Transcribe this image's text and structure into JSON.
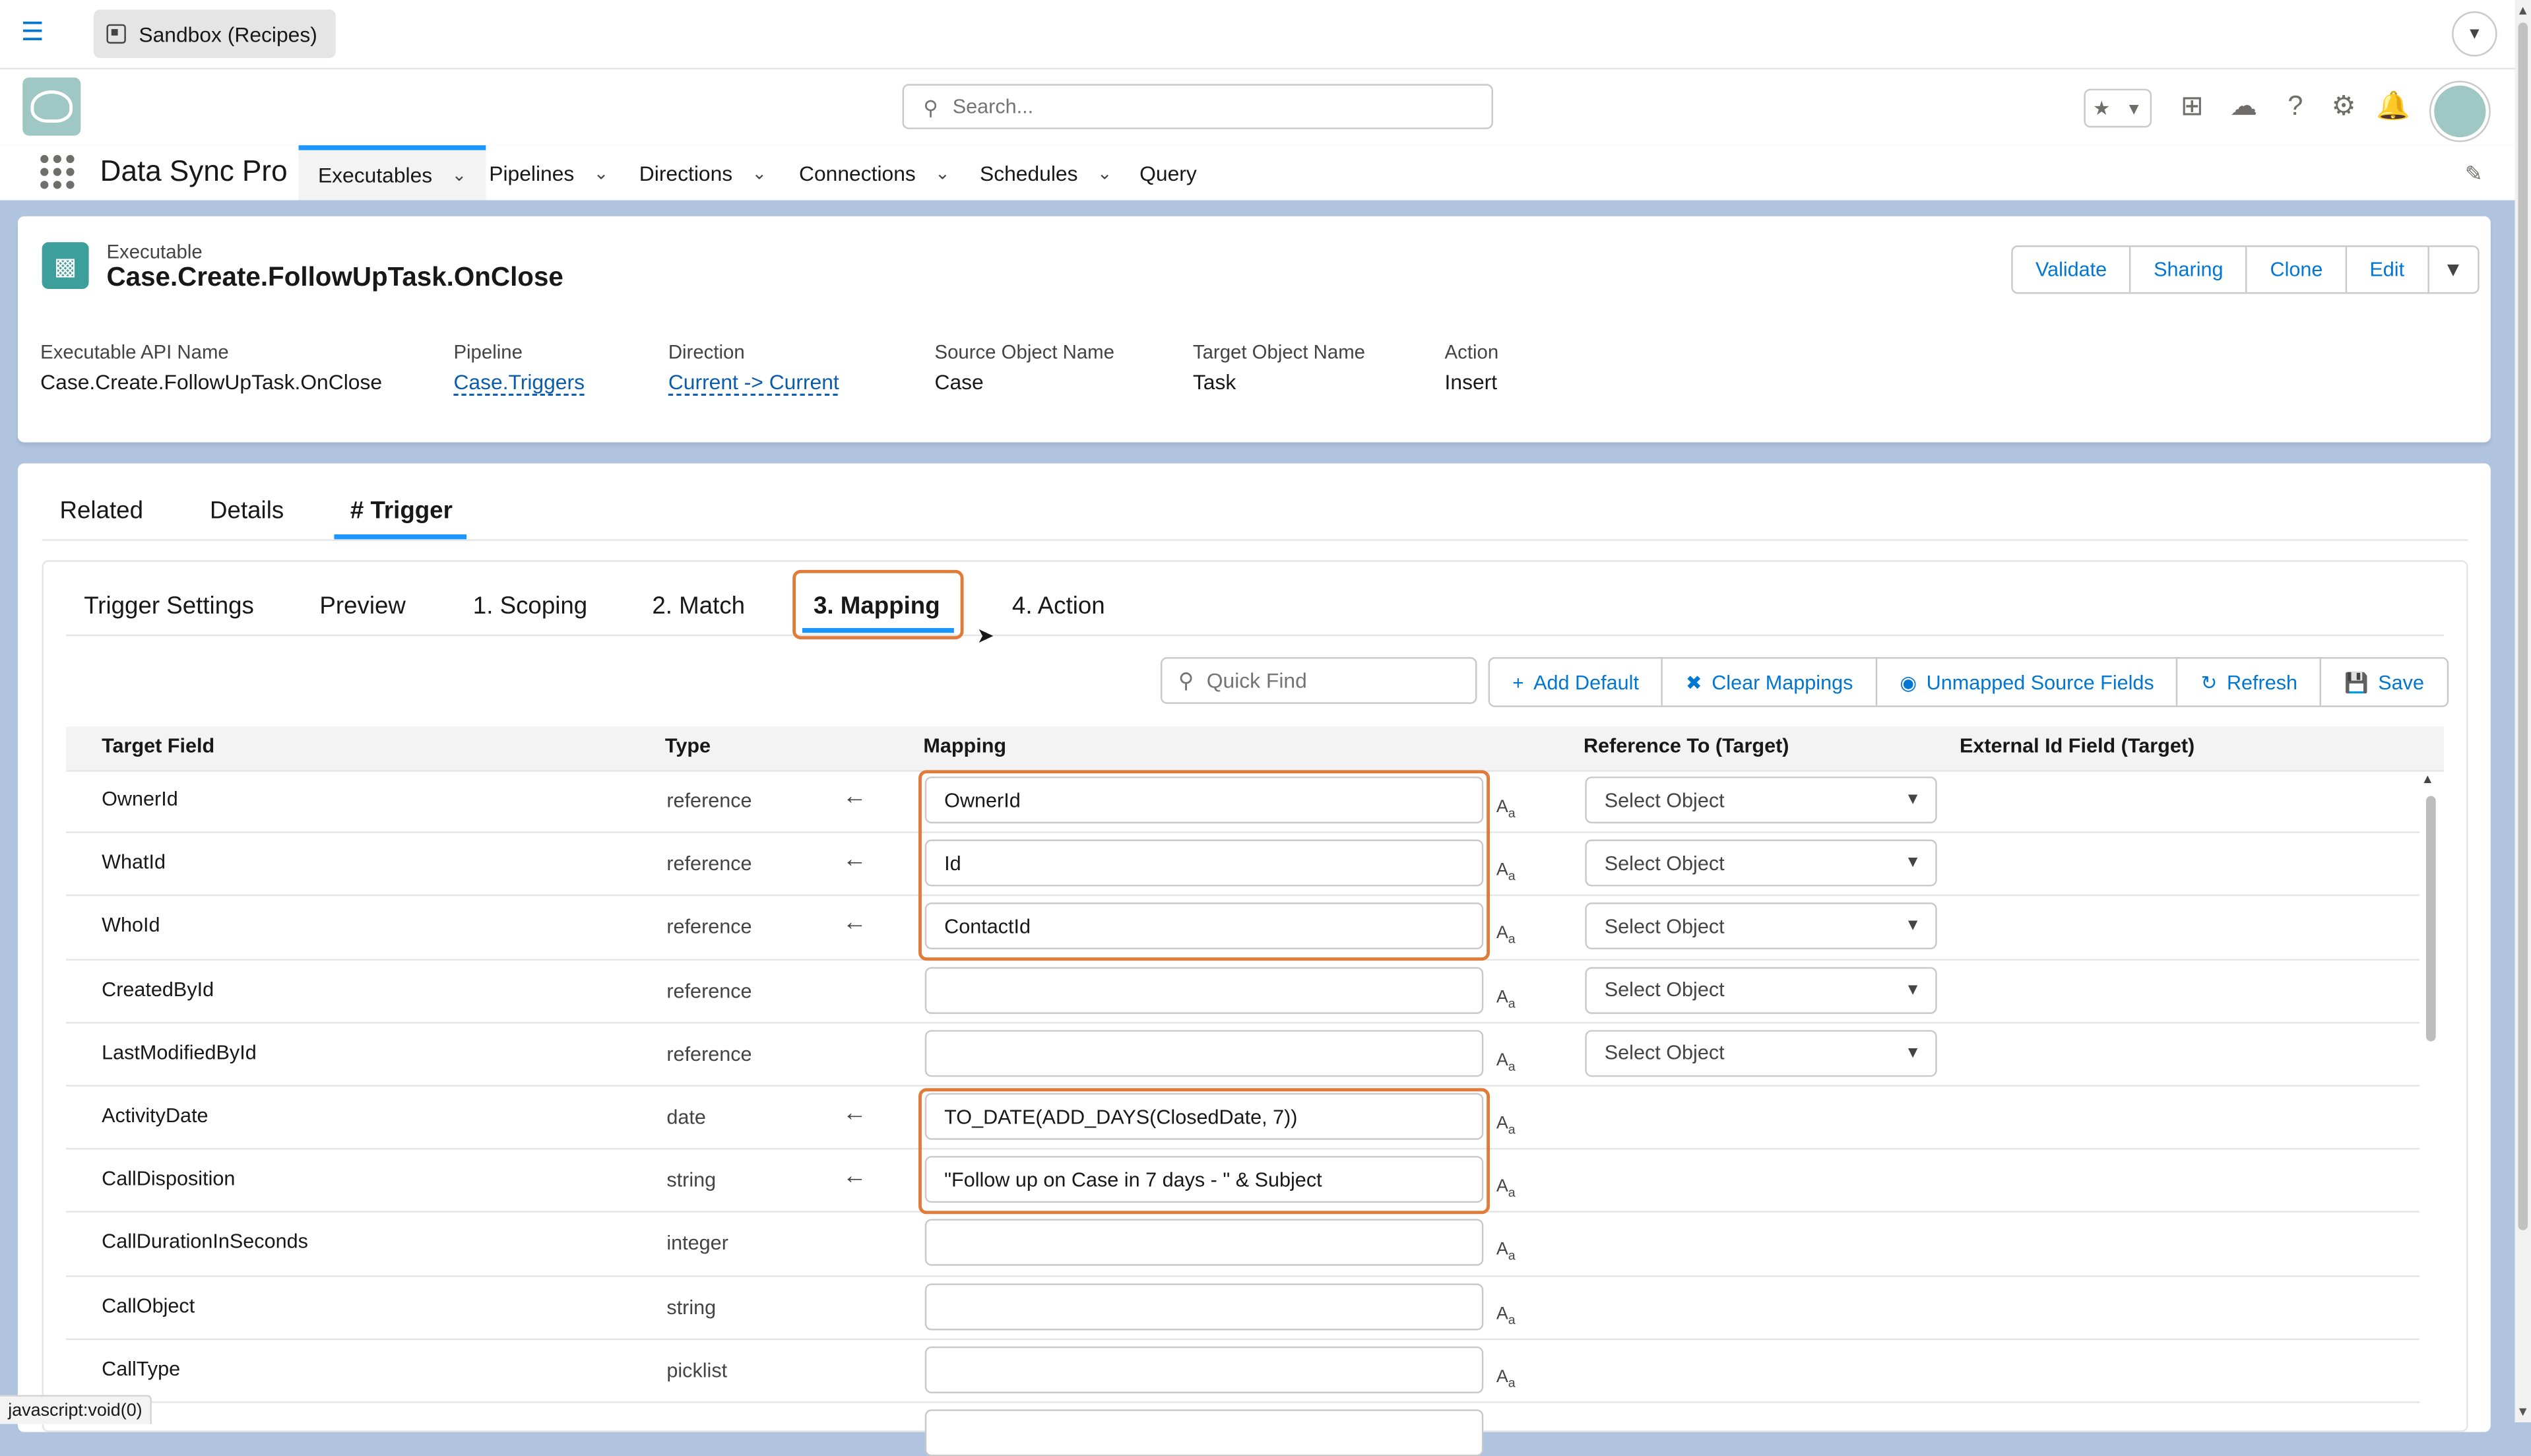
{
  "top_bar": {
    "sandbox_label": "Sandbox (Recipes)"
  },
  "header": {
    "search_placeholder": "Search..."
  },
  "nav": {
    "app_name": "Data Sync Pro",
    "items": [
      {
        "label": "Executables"
      },
      {
        "label": "Pipelines"
      },
      {
        "label": "Directions"
      },
      {
        "label": "Connections"
      },
      {
        "label": "Schedules"
      },
      {
        "label": "Query"
      }
    ]
  },
  "record": {
    "object_type": "Executable",
    "title": "Case.Create.FollowUpTask.OnClose",
    "actions": [
      "Validate",
      "Sharing",
      "Clone",
      "Edit"
    ],
    "fields": [
      {
        "label": "Executable API Name",
        "value": "Case.Create.FollowUpTask.OnClose"
      },
      {
        "label": "Pipeline",
        "value": "Case.Triggers"
      },
      {
        "label": "Direction",
        "value": "Current -> Current"
      },
      {
        "label": "Source Object Name",
        "value": "Case"
      },
      {
        "label": "Target Object Name",
        "value": "Task"
      },
      {
        "label": "Action",
        "value": "Insert"
      }
    ]
  },
  "main_tabs": [
    {
      "label": "Related"
    },
    {
      "label": "Details"
    },
    {
      "label": "# Trigger"
    }
  ],
  "trigger_tabs": [
    {
      "label": "Trigger Settings"
    },
    {
      "label": "Preview"
    },
    {
      "label": "1. Scoping"
    },
    {
      "label": "2. Match"
    },
    {
      "label": "3. Mapping"
    },
    {
      "label": "4. Action"
    }
  ],
  "toolbar": {
    "quick_find_placeholder": "Quick Find",
    "buttons": [
      "Add Default",
      "Clear Mappings",
      "Unmapped Source Fields",
      "Refresh",
      "Save"
    ]
  },
  "table": {
    "headers": [
      "Target Field",
      "Type",
      "Mapping",
      "Reference To (Target)",
      "External Id Field (Target)"
    ],
    "select_placeholder": "Select Object",
    "rows": [
      {
        "field": "OwnerId",
        "type": "reference",
        "mapping": "OwnerId"
      },
      {
        "field": "WhatId",
        "type": "reference",
        "mapping": "Id"
      },
      {
        "field": "WhoId",
        "type": "reference",
        "mapping": "ContactId"
      },
      {
        "field": "CreatedById",
        "type": "reference",
        "mapping": ""
      },
      {
        "field": "LastModifiedById",
        "type": "reference",
        "mapping": ""
      },
      {
        "field": "ActivityDate",
        "type": "date",
        "mapping": "TO_DATE(ADD_DAYS(ClosedDate, 7))"
      },
      {
        "field": "CallDisposition",
        "type": "string",
        "mapping": "\"Follow up on Case in 7 days - \" & Subject"
      },
      {
        "field": "CallDurationInSeconds",
        "type": "integer",
        "mapping": ""
      },
      {
        "field": "CallObject",
        "type": "string",
        "mapping": ""
      },
      {
        "field": "CallType",
        "type": "picklist",
        "mapping": ""
      }
    ]
  },
  "status_bar": {
    "text": "javascript:void(0)"
  },
  "colors": {
    "accent": "#0176d3",
    "highlight": "#e07b39",
    "background": "#b0c4df"
  }
}
